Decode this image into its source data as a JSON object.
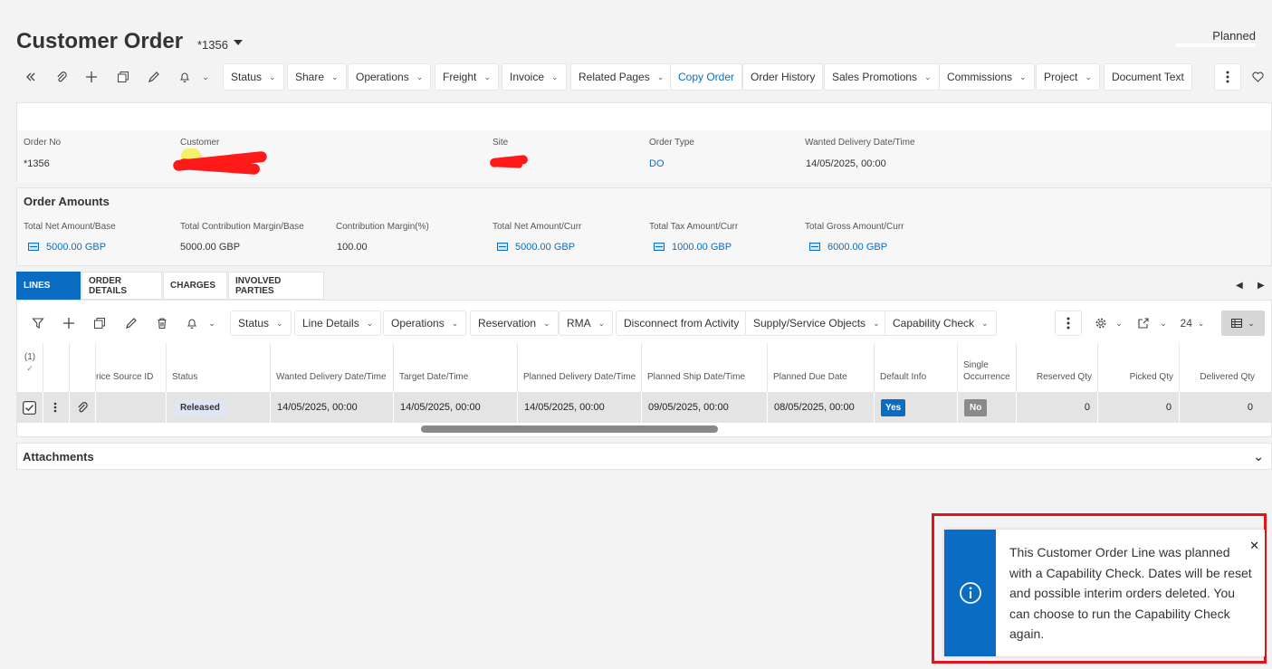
{
  "header": {
    "title": "Customer Order",
    "order_ref": "*1356",
    "state": "Planned"
  },
  "toolbar": {
    "buttons": [
      {
        "label": "Status",
        "dropdown": true
      },
      {
        "label": "Share",
        "dropdown": true
      },
      {
        "label": "Operations",
        "dropdown": true
      },
      {
        "label": "Freight",
        "dropdown": true
      },
      {
        "label": "Invoice",
        "dropdown": true
      },
      {
        "label": "Related Pages",
        "dropdown": true
      },
      {
        "label": "Copy Order",
        "dropdown": false
      },
      {
        "label": "Order History",
        "dropdown": false
      },
      {
        "label": "Sales Promotions",
        "dropdown": true
      },
      {
        "label": "Commissions",
        "dropdown": true
      },
      {
        "label": "Project",
        "dropdown": true
      },
      {
        "label": "Document Text",
        "dropdown": false
      }
    ]
  },
  "order_header": {
    "order_no_label": "Order No",
    "order_no": "*1356",
    "customer_label": "Customer",
    "site_label": "Site",
    "order_type_label": "Order Type",
    "order_type": "DO",
    "wanted_delivery_label": "Wanted Delivery Date/Time",
    "wanted_delivery": "14/05/2025, 00:00"
  },
  "order_amounts": {
    "title": "Order Amounts",
    "fields": [
      {
        "label": "Total Net Amount/Base",
        "value": "5000.00 GBP",
        "link": true
      },
      {
        "label": "Total Contribution Margin/Base",
        "value": "5000.00 GBP",
        "link": false
      },
      {
        "label": "Contribution Margin(%)",
        "value": "100.00",
        "link": false
      },
      {
        "label": "Total Net Amount/Curr",
        "value": "5000.00 GBP",
        "link": true
      },
      {
        "label": "Total Tax Amount/Curr",
        "value": "1000.00 GBP",
        "link": true
      },
      {
        "label": "Total Gross Amount/Curr",
        "value": "6000.00 GBP",
        "link": true
      }
    ]
  },
  "tabs": [
    "LINES",
    "ORDER DETAILS",
    "CHARGES",
    "INVOLVED PARTIES"
  ],
  "lines_toolbar": {
    "buttons": [
      "Status",
      "Line Details",
      "Operations",
      "Reservation",
      "RMA",
      "Disconnect from Activity",
      "Supply/Service Objects",
      "Capability Check"
    ],
    "page_size": "24"
  },
  "lines_grid": {
    "selected_count": "(1)",
    "columns": [
      "rice Source ID",
      "Status",
      "Wanted Delivery Date/Time",
      "Target Date/Time",
      "Planned Delivery Date/Time",
      "Planned Ship Date/Time",
      "Planned Due Date",
      "Default Info",
      "Single Occurrence",
      "Reserved Qty",
      "Picked Qty",
      "Delivered Qty"
    ],
    "row": {
      "status": "Released",
      "wanted_delivery": "14/05/2025, 00:00",
      "target": "14/05/2025, 00:00",
      "planned_delivery": "14/05/2025, 00:00",
      "planned_ship": "09/05/2025, 00:00",
      "planned_due": "08/05/2025, 00:00",
      "default_info": "Yes",
      "single_occurrence": "No",
      "reserved_qty": "0",
      "picked_qty": "0",
      "delivered_qty": "0"
    }
  },
  "attachments": {
    "title": "Attachments"
  },
  "notification": {
    "message": "This Customer Order Line was planned with a Capability Check. Dates will be reset and possible interim orders deleted. You can choose to run the Capability Check again."
  },
  "colors": {
    "accent": "#0b6cc4",
    "highlight": "#e1141b"
  }
}
